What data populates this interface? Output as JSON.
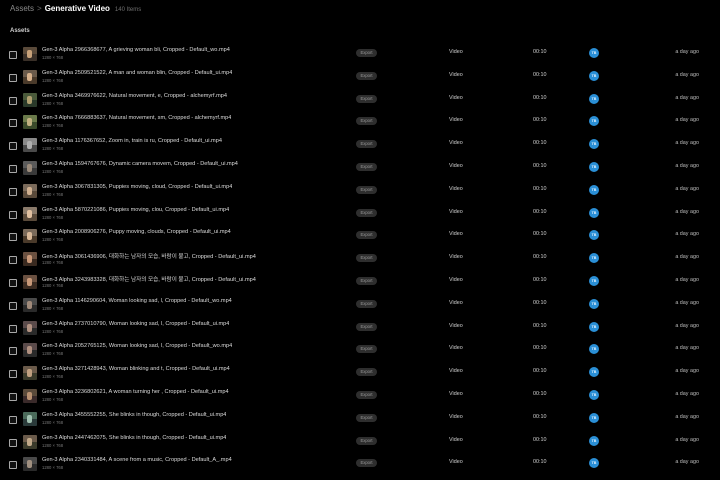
{
  "breadcrumb": {
    "root": "Assets",
    "separator": ">",
    "current": "Generative Video",
    "count": "140 Items"
  },
  "section_label": "Assets",
  "colors": {
    "background": "#000000",
    "avatar": "#2a8fd6",
    "badge": "#2e2e2e"
  },
  "row_defaults": {
    "resolution": "1280 × 768",
    "badge": "Export",
    "type": "Video",
    "duration": "00:10",
    "avatar": "TB",
    "modified": "a day ago"
  },
  "rows": [
    {
      "name": "Gen-3 Alpha 2966368677, A grieving woman bli, Cropped - Default_wo.mp4",
      "thumb": [
        "#5a4a3a",
        "#3a3028",
        "#c8a27a"
      ]
    },
    {
      "name": "Gen-3 Alpha 2509521522, A man and woman blin, Cropped - Default_ui.mp4",
      "thumb": [
        "#6a5a4a",
        "#4a3a2a",
        "#d6b08a"
      ]
    },
    {
      "name": "Gen-3 Alpha 3469976622, Natural movement, e, Cropped - alchemyrf.mp4",
      "thumb": [
        "#4a5a3a",
        "#2a3a2a",
        "#b0a070"
      ]
    },
    {
      "name": "Gen-3 Alpha 7666883637, Natural movement, sm, Cropped - alchemyrf.mp4",
      "thumb": [
        "#6a7a4a",
        "#3a4a2a",
        "#c0b080"
      ]
    },
    {
      "name": "Gen-3 Alpha 1176367652, Zoom in, train is ru, Cropped - Default_ui.mp4",
      "thumb": [
        "#8a8a8a",
        "#4a4a4a",
        "#b0b0b0"
      ]
    },
    {
      "name": "Gen-3 Alpha 1594767676, Dynamic camera movem, Cropped - Default_ui.mp4",
      "thumb": [
        "#5a5a5a",
        "#3a3a3a",
        "#9a8a7a"
      ]
    },
    {
      "name": "Gen-3 Alpha 3067831305, Puppies moving, cloud, Cropped - Default_ui.mp4",
      "thumb": [
        "#7a6a5a",
        "#5a4a3a",
        "#d0b090"
      ]
    },
    {
      "name": "Gen-3 Alpha 5870221086, Puppies moving, clou, Cropped - Default_ui.mp4",
      "thumb": [
        "#8a7a6a",
        "#5a4a3a",
        "#e0c0a0"
      ]
    },
    {
      "name": "Gen-3 Alpha 2008906276, Puppy moving, clouds, Cropped - Default_ui.mp4",
      "thumb": [
        "#7a6a5a",
        "#4a3a2a",
        "#d8b898"
      ]
    },
    {
      "name": "Gen-3 Alpha 3061436906, 대화하는 남자의 모습, 바람이 불고, Cropped - Default_ui.mp4",
      "thumb": [
        "#6a5040",
        "#3a2a20",
        "#c89878"
      ]
    },
    {
      "name": "Gen-3 Alpha 3243983328, 대화하는 남자의 모습, 바람이 불고, Cropped - Default_ui.mp4",
      "thumb": [
        "#6a5040",
        "#3a2a20",
        "#c89878"
      ]
    },
    {
      "name": "Gen-3 Alpha 1146290604, Woman looking sad, l, Cropped - Default_wo.mp4",
      "thumb": [
        "#4a4a4a",
        "#2a2a2a",
        "#a08a7a"
      ]
    },
    {
      "name": "Gen-3 Alpha 2737010790, Woman looking sad, l, Cropped - Default_ui.mp4",
      "thumb": [
        "#5a4a4a",
        "#2a2a2a",
        "#b09080"
      ]
    },
    {
      "name": "Gen-3 Alpha 2052765125, Woman looking sad, l, Cropped - Default_wo.mp4",
      "thumb": [
        "#5a4a4a",
        "#2a2a2a",
        "#b09080"
      ]
    },
    {
      "name": "Gen-3 Alpha 3271428943, Woman blinking and t, Cropped - Default_ui.mp4",
      "thumb": [
        "#6a5a4a",
        "#3a3a2a",
        "#c0a080"
      ]
    },
    {
      "name": "Gen-3 Alpha 3236802621, A woman turning her , Cropped - Default_ui.mp4",
      "thumb": [
        "#5a4a3a",
        "#3a2a2a",
        "#b89070"
      ]
    },
    {
      "name": "Gen-3 Alpha 3455552255, She blinks in though, Cropped - Default_ui.mp4",
      "thumb": [
        "#4a6a5a",
        "#2a3a3a",
        "#a0c0b0"
      ]
    },
    {
      "name": "Gen-3 Alpha 2447462075, She blinks in though, Cropped - Default_ui.mp4",
      "thumb": [
        "#6a5a4a",
        "#3a3a2a",
        "#c0a888"
      ]
    },
    {
      "name": "Gen-3 Alpha 2340331484, A scene from a music, Cropped - Default_A_.mp4",
      "thumb": [
        "#4a4a4a",
        "#2a2a2a",
        "#a09080"
      ]
    }
  ]
}
